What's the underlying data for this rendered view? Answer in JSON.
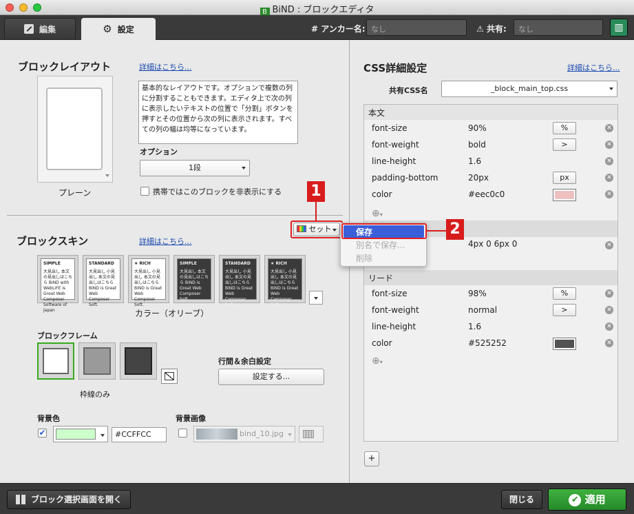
{
  "window": {
    "title": "BiND : ブロックエディタ"
  },
  "toolbar": {
    "tab_edit": "編集",
    "tab_settings": "設定",
    "anchor_label": "# アンカー名:",
    "anchor_value": "なし",
    "share_label": "共有:",
    "share_value": "なし"
  },
  "left": {
    "block_layout": {
      "title": "ブロックレイアウト",
      "detail_link": "詳細はこちら...",
      "description": "基本的なレイアウトです。オプションで複数の列に分割することもできます。エディタ上で次の列に表示したいテキストの位置で「分割」ボタンを押すとその位置から次の列に表示されます。すべての列の幅は均等になっています。",
      "layout_name": "プレーン",
      "option_label": "オプション",
      "option_value": "1段",
      "hide_mobile_label": "携帯ではこのブロックを非表示にする"
    },
    "set_button": "セット",
    "set_menu": {
      "items": [
        "保存",
        "別名で保存...",
        "削除"
      ]
    },
    "block_skin": {
      "title": "ブロックスキン",
      "detail_link": "詳細はこちら...",
      "skins": [
        {
          "label": "SIMPLE",
          "body": "大見出し 本文の見出しはこちら BiND with WebLiFE is Great Web Composer Software of Japan"
        },
        {
          "label": "STANDARD",
          "body": "大見出し 小見出し 本文の見出しはこちら BiND is Great Web Composer Soft."
        },
        {
          "label": "★ RICH",
          "body": "大見出し 小見出し 本文の見出しはこちら BiND is Great Web Composer Soft."
        },
        {
          "label": "SIMPLE",
          "body": "大見出し 本文の見出しはこちら BiND is Great Web Composer Soft."
        },
        {
          "label": "STANDARD",
          "body": "大見出し 小見出し 本文の見出しはこちら BiND is Great Web Composer Soft."
        },
        {
          "label": "★ RICH",
          "body": "大見出し 小見出し 本文の見出しはこちら BiND is Great Web Composer Soft."
        }
      ],
      "color_name": "カラー（オリーブ）"
    },
    "block_frame": {
      "title": "ブロックフレーム",
      "frame_name": "枠線のみ"
    },
    "spacing": {
      "label": "行間＆余白設定",
      "button": "設定する..."
    },
    "bg_color": {
      "label": "背景色",
      "value": "#CCFFCC",
      "swatch": "#ccffcc"
    },
    "bg_image": {
      "label": "背景画像",
      "value": "bind_10.jpg"
    }
  },
  "right": {
    "title": "CSS詳細設定",
    "detail_link": "詳細はこちら...",
    "shared_css_label": "共有CSS名",
    "shared_css_value": "_block_main_top.css",
    "section_body": "本文",
    "body_rows": [
      {
        "key": "font-size",
        "value": "90%",
        "unit": "%"
      },
      {
        "key": "font-weight",
        "value": "bold",
        "unit": ">"
      },
      {
        "key": "line-height",
        "value": "1.6",
        "unit": ""
      },
      {
        "key": "padding-bottom",
        "value": "20px",
        "unit": "px"
      },
      {
        "key": "color",
        "value": "#eec0c0",
        "unit": ""
      }
    ],
    "hidden_row_value": "4px 0 6px 0",
    "section_lead": "リード",
    "lead_rows": [
      {
        "key": "font-size",
        "value": "98%",
        "unit": "%"
      },
      {
        "key": "font-weight",
        "value": "normal",
        "unit": ">"
      },
      {
        "key": "line-height",
        "value": "1.6",
        "unit": ""
      },
      {
        "key": "color",
        "value": "#525252",
        "unit": ""
      }
    ],
    "add_button": "+"
  },
  "bottom": {
    "open_block_select": "ブロック選択画面を開く",
    "close": "閉じる",
    "apply": "適用"
  },
  "annotations": {
    "badge1": "1",
    "badge2": "2"
  },
  "colors": {
    "accent_blue": "#3b5fd9",
    "apply_green": "#2e9a2e",
    "annotation_red": "#d81c1c",
    "body_color": "#eec0c0",
    "lead_color": "#525252"
  }
}
